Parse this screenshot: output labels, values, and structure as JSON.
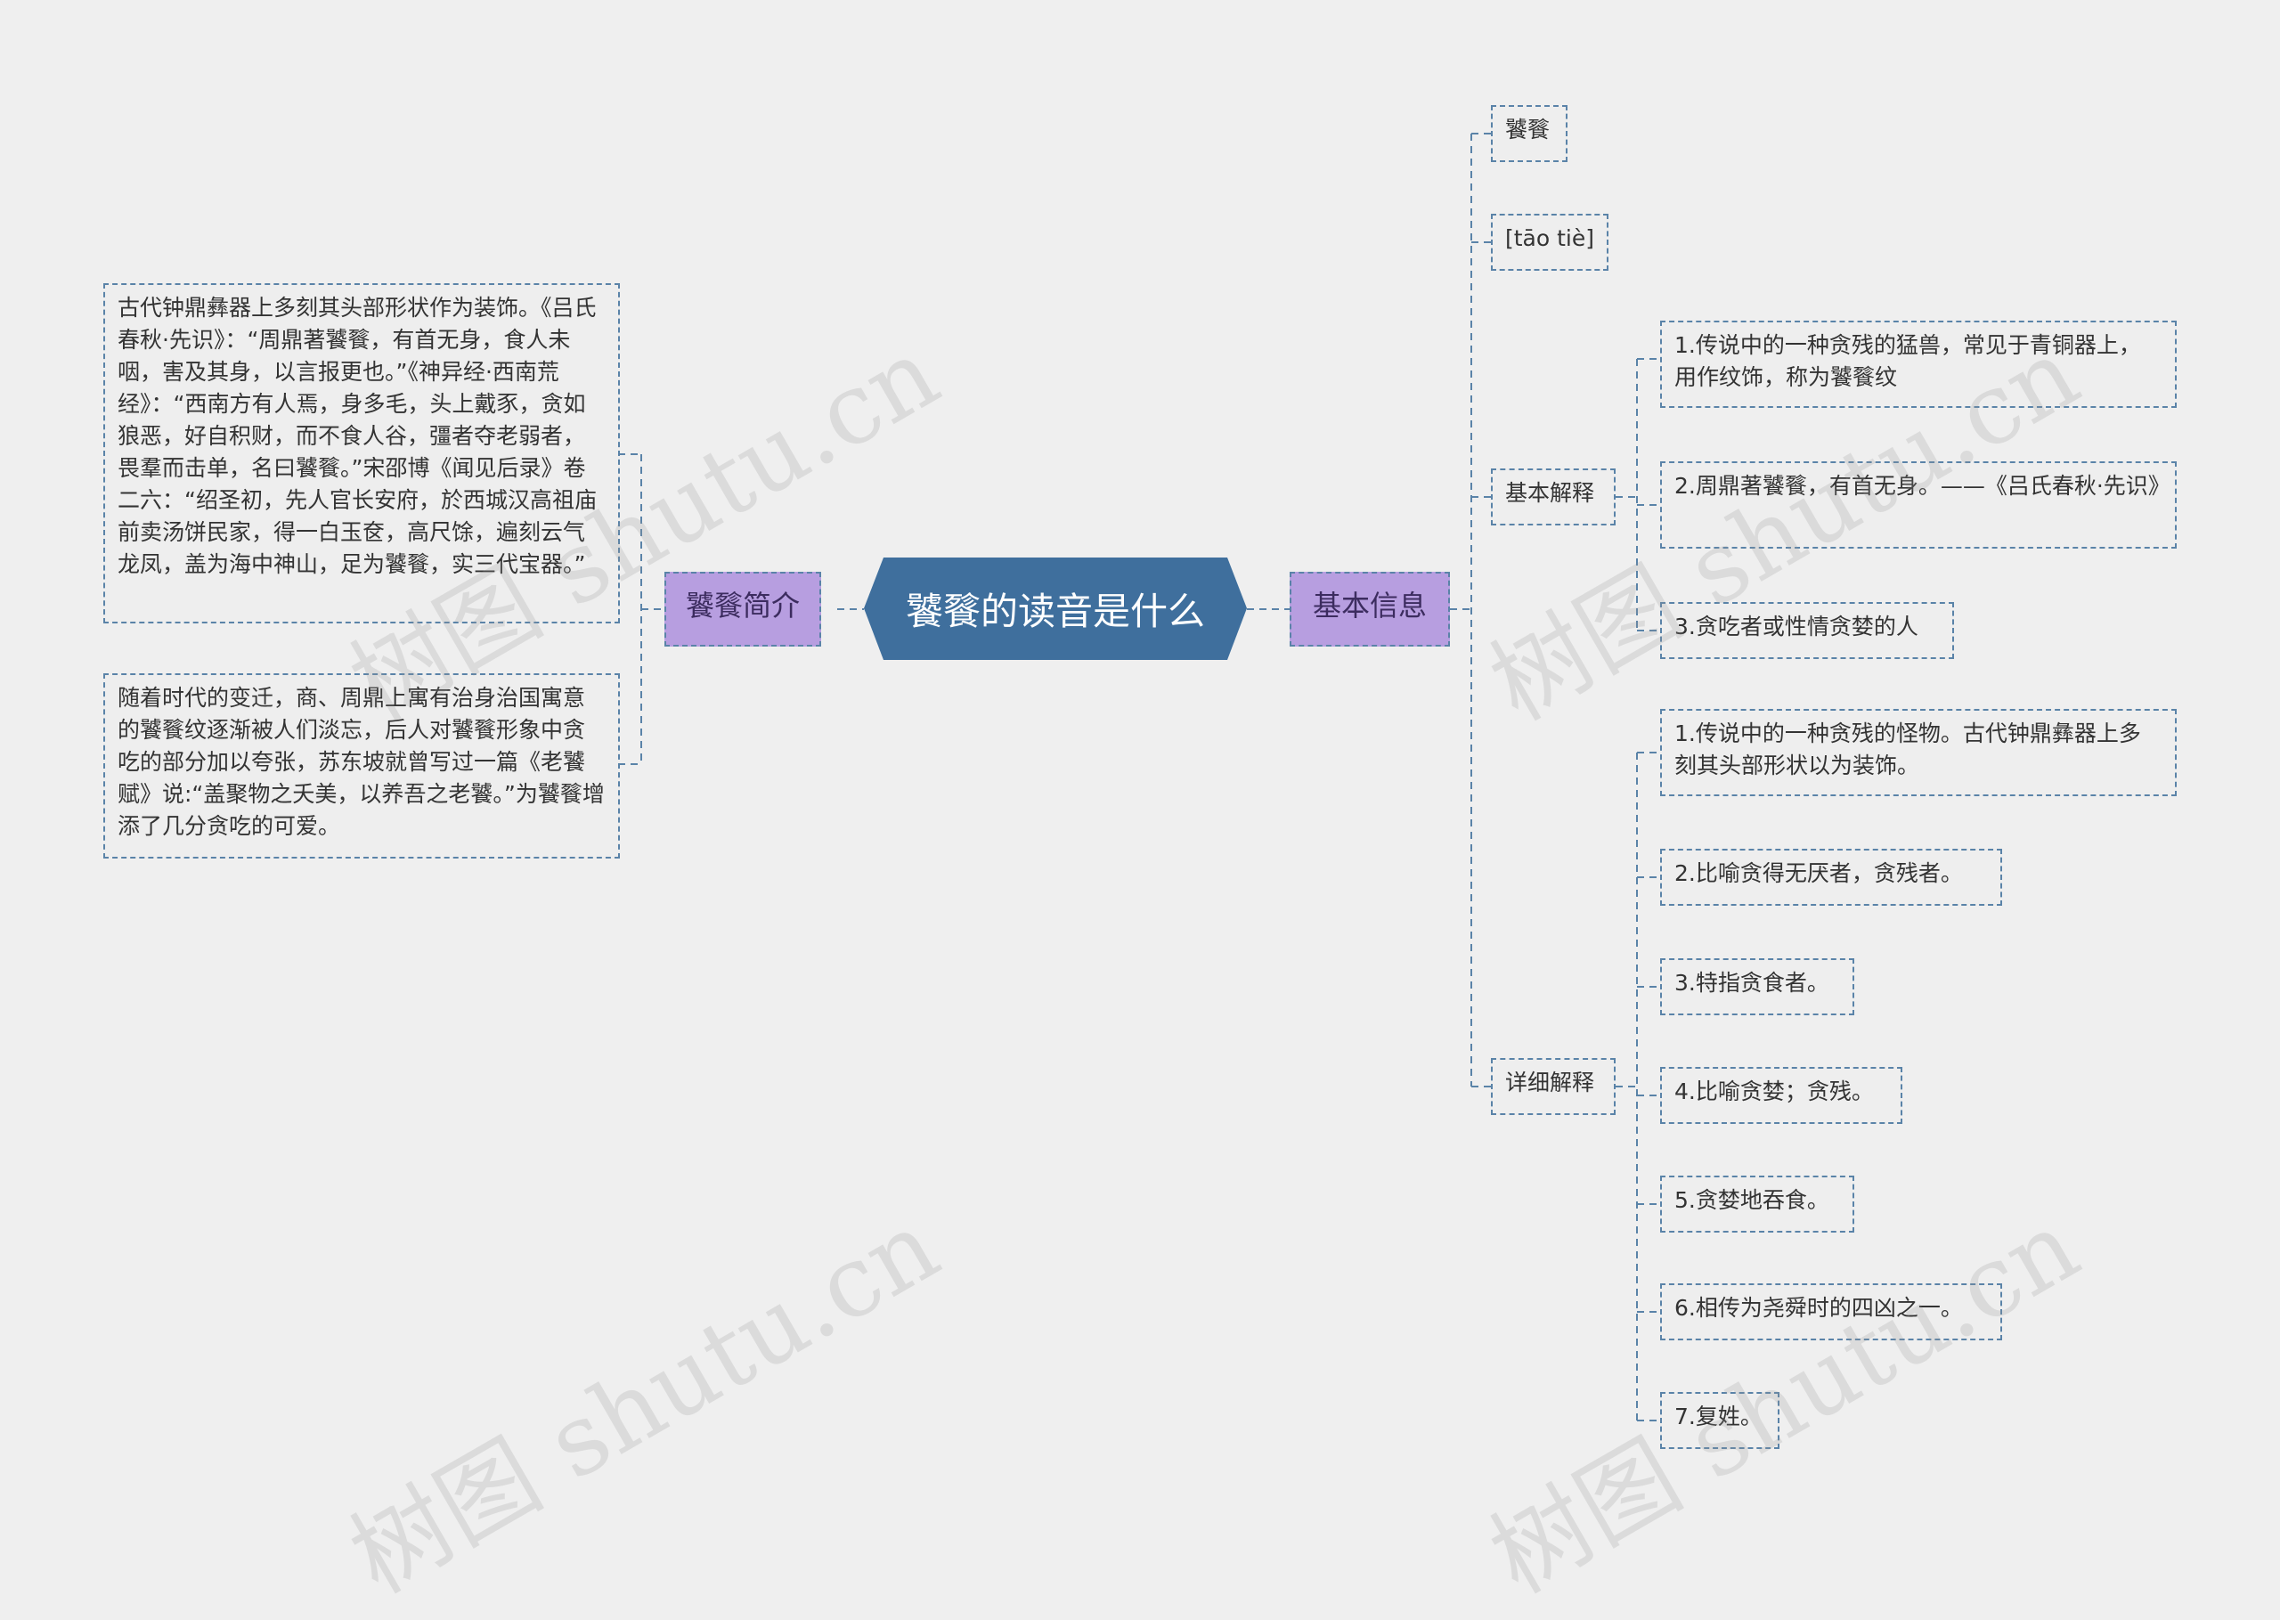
{
  "center_title": "饕餮的读音是什么",
  "left_branch": {
    "label": "饕餮简介",
    "notes": [
      "古代钟鼎彝器上多刻其头部形状作为装饰。《吕氏春秋·先识》：“周鼎著饕餮，有首无身，食人未咽，害及其身，以言报更也。”《神异经·西南荒经》：“西南方有人焉，身多毛，头上戴豕，贪如狼恶，好自积财，而不食人谷，彊者夺老弱者，畏羣而击单，名曰饕餮。”宋邵博《闻见后录》卷二六：“绍圣初，先人官长安府，於西城汉高祖庙前卖汤饼民家，得一白玉奁，高尺馀，遍刻云气龙凤，盖为海中神山，足为饕餮，实三代宝器。”",
      "随着时代的变迁，商、周鼎上寓有治身治国寓意的饕餮纹逐渐被人们淡忘，后人对饕餮形象中贪吃的部分加以夸张，苏东坡就曾写过一篇《老饕赋》说:“盖聚物之夭美，以养吾之老饕。”为饕餮增添了几分贪吃的可爱。"
    ]
  },
  "right_branch": {
    "label": "基本信息",
    "word": "饕餮",
    "pinyin": "[tāo tiè]",
    "basic": {
      "label": "基本解释",
      "items": [
        "1.传说中的一种贪残的猛兽，常见于青铜器上，用作纹饰，称为饕餮纹",
        "2.周鼎著饕餮，有首无身。——《吕氏春秋·先识》",
        "3.贪吃者或性情贪婪的人"
      ]
    },
    "detail": {
      "label": "详细解释",
      "items": [
        "1.传说中的一种贪残的怪物。古代钟鼎彝器上多刻其头部形状以为装饰。",
        "2.比喻贪得无厌者，贪残者。",
        "3.特指贪食者。",
        "4.比喻贪婪；贪残。",
        "5.贪婪地吞食。",
        "6.相传为尧舜时的四凶之一。",
        "7.复姓。"
      ]
    }
  },
  "watermark_text": "树图 shutu.cn",
  "colors": {
    "background": "#efefef",
    "center_fill": "#3f6f9d",
    "branch_fill": "#b79ee0",
    "border": "#5a83a8"
  }
}
